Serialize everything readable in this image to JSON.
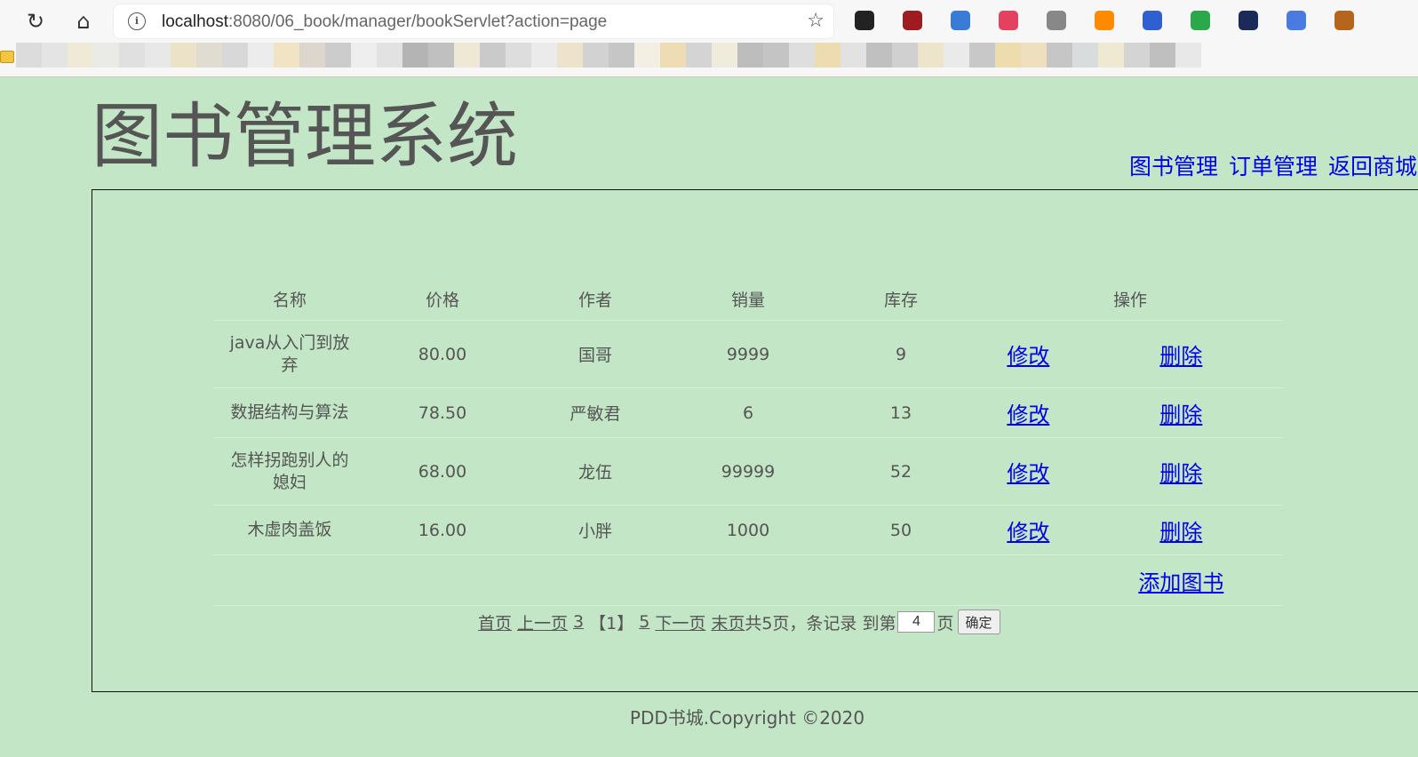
{
  "browser": {
    "url_host": "localhost",
    "url_rest": ":8080/06_book/manager/bookServlet?action=page",
    "extensions": [
      "tampermonkey-icon",
      "ublock-icon",
      "bookmark-ext-icon",
      "screenshot-ext-icon",
      "translate-ext-icon",
      "wallet-ext-icon",
      "cleaner-ext-icon",
      "eye-ext-icon",
      "dark-ext-icon",
      "google-translate-icon",
      "monkey-ext-icon"
    ]
  },
  "header": {
    "title": "图书管理系统",
    "links": [
      "图书管理",
      "订单管理",
      "返回商城"
    ]
  },
  "table": {
    "headers": [
      "名称",
      "价格",
      "作者",
      "销量",
      "库存",
      "操作"
    ],
    "rows": [
      {
        "name": "java从入门到放弃",
        "price": "80.00",
        "author": "国哥",
        "sales": "9999",
        "stock": "9",
        "edit": "修改",
        "delete": "删除"
      },
      {
        "name": "数据结构与算法",
        "price": "78.50",
        "author": "严敏君",
        "sales": "6",
        "stock": "13",
        "edit": "修改",
        "delete": "删除"
      },
      {
        "name": "怎样拐跑别人的媳妇",
        "price": "68.00",
        "author": "龙伍",
        "sales": "99999",
        "stock": "52",
        "edit": "修改",
        "delete": "删除"
      },
      {
        "name": "木虚肉盖饭",
        "price": "16.00",
        "author": "小胖",
        "sales": "1000",
        "stock": "50",
        "edit": "修改",
        "delete": "删除"
      }
    ],
    "add_label": "添加图书"
  },
  "pager": {
    "first": "首页",
    "prev": "上一页",
    "page_prev": "3",
    "current": "【1】",
    "page_next": "5",
    "next": "下一页",
    "last": "末页",
    "summary": "共5页，条记录 到第",
    "input_value": "4",
    "page_suffix": "页",
    "confirm": "确定"
  },
  "footer": "PDD书城.Copyright ©2020"
}
